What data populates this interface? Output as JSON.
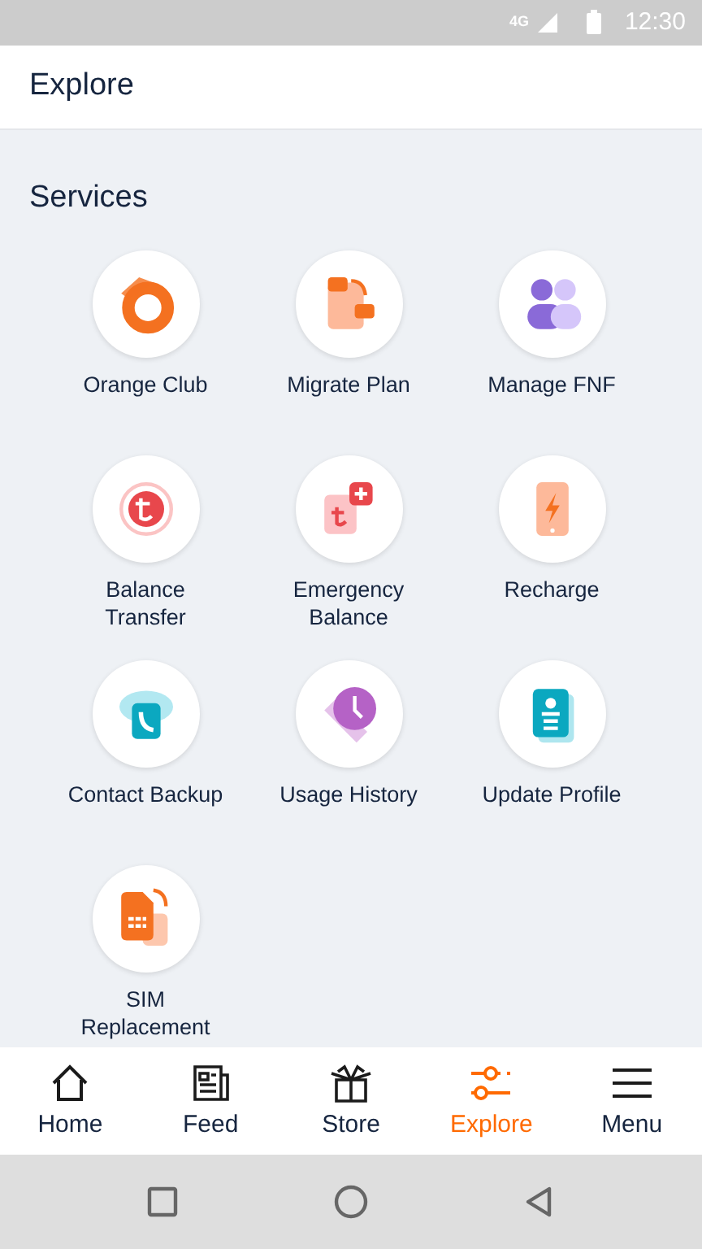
{
  "status_bar": {
    "network": "4G",
    "time": "12:30"
  },
  "header": {
    "title": "Explore"
  },
  "section": {
    "title": "Services"
  },
  "services": [
    {
      "label": "Orange Club"
    },
    {
      "label": "Migrate Plan"
    },
    {
      "label": "Manage FNF"
    },
    {
      "label": "Balance Transfer"
    },
    {
      "label": "Emergency Balance"
    },
    {
      "label": "Recharge"
    },
    {
      "label": "Contact Backup"
    },
    {
      "label": "Usage History"
    },
    {
      "label": "Update Profile"
    },
    {
      "label": "SIM Replacement"
    }
  ],
  "nav": [
    {
      "label": "Home",
      "selected": false
    },
    {
      "label": "Feed",
      "selected": false
    },
    {
      "label": "Store",
      "selected": false
    },
    {
      "label": "Explore",
      "selected": true
    },
    {
      "label": "Menu",
      "selected": false
    }
  ]
}
